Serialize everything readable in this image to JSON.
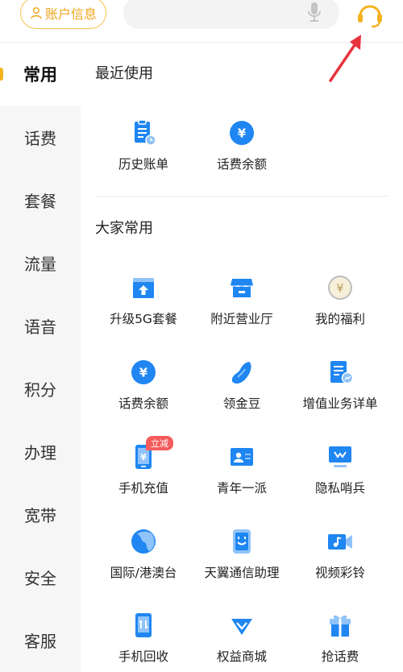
{
  "header": {
    "account_label": "账户信息",
    "search_placeholder": ""
  },
  "sidebar": {
    "items": [
      {
        "label": "常用",
        "active": true
      },
      {
        "label": "话费"
      },
      {
        "label": "套餐"
      },
      {
        "label": "流量"
      },
      {
        "label": "语音"
      },
      {
        "label": "积分"
      },
      {
        "label": "办理"
      },
      {
        "label": "宽带"
      },
      {
        "label": "安全"
      },
      {
        "label": "客服"
      }
    ]
  },
  "main": {
    "recent_title": "最近使用",
    "recent": [
      {
        "label": "历史账单",
        "icon": "bill-icon"
      },
      {
        "label": "话费余额",
        "icon": "yuan-coin-icon"
      }
    ],
    "common_title": "大家常用",
    "common": [
      {
        "label": "升级5G套餐",
        "icon": "upgrade-5g-icon"
      },
      {
        "label": "附近营业厅",
        "icon": "store-icon"
      },
      {
        "label": "我的福利",
        "icon": "welfare-coin-icon"
      },
      {
        "label": "话费余额",
        "icon": "yuan-coin-icon"
      },
      {
        "label": "领金豆",
        "icon": "bean-icon"
      },
      {
        "label": "增值业务详单",
        "icon": "doc-chart-icon"
      },
      {
        "label": "手机充值",
        "icon": "phone-recharge-icon",
        "badge": "立减"
      },
      {
        "label": "青年一派",
        "icon": "id-card-icon"
      },
      {
        "label": "隐私哨兵",
        "icon": "monitor-icon"
      },
      {
        "label": "国际/港澳台",
        "icon": "globe-icon"
      },
      {
        "label": "天翼通信助理",
        "icon": "assistant-phone-icon"
      },
      {
        "label": "视频彩铃",
        "icon": "video-ring-icon"
      },
      {
        "label": "手机回收",
        "icon": "phone-recycle-icon"
      },
      {
        "label": "权益商城",
        "icon": "diamond-icon"
      },
      {
        "label": "抢话费",
        "icon": "gift-icon"
      }
    ]
  },
  "colors": {
    "accent": "#f5b21d",
    "icon_blue": "#1f86f2",
    "badge_red": "#f45c5c"
  }
}
